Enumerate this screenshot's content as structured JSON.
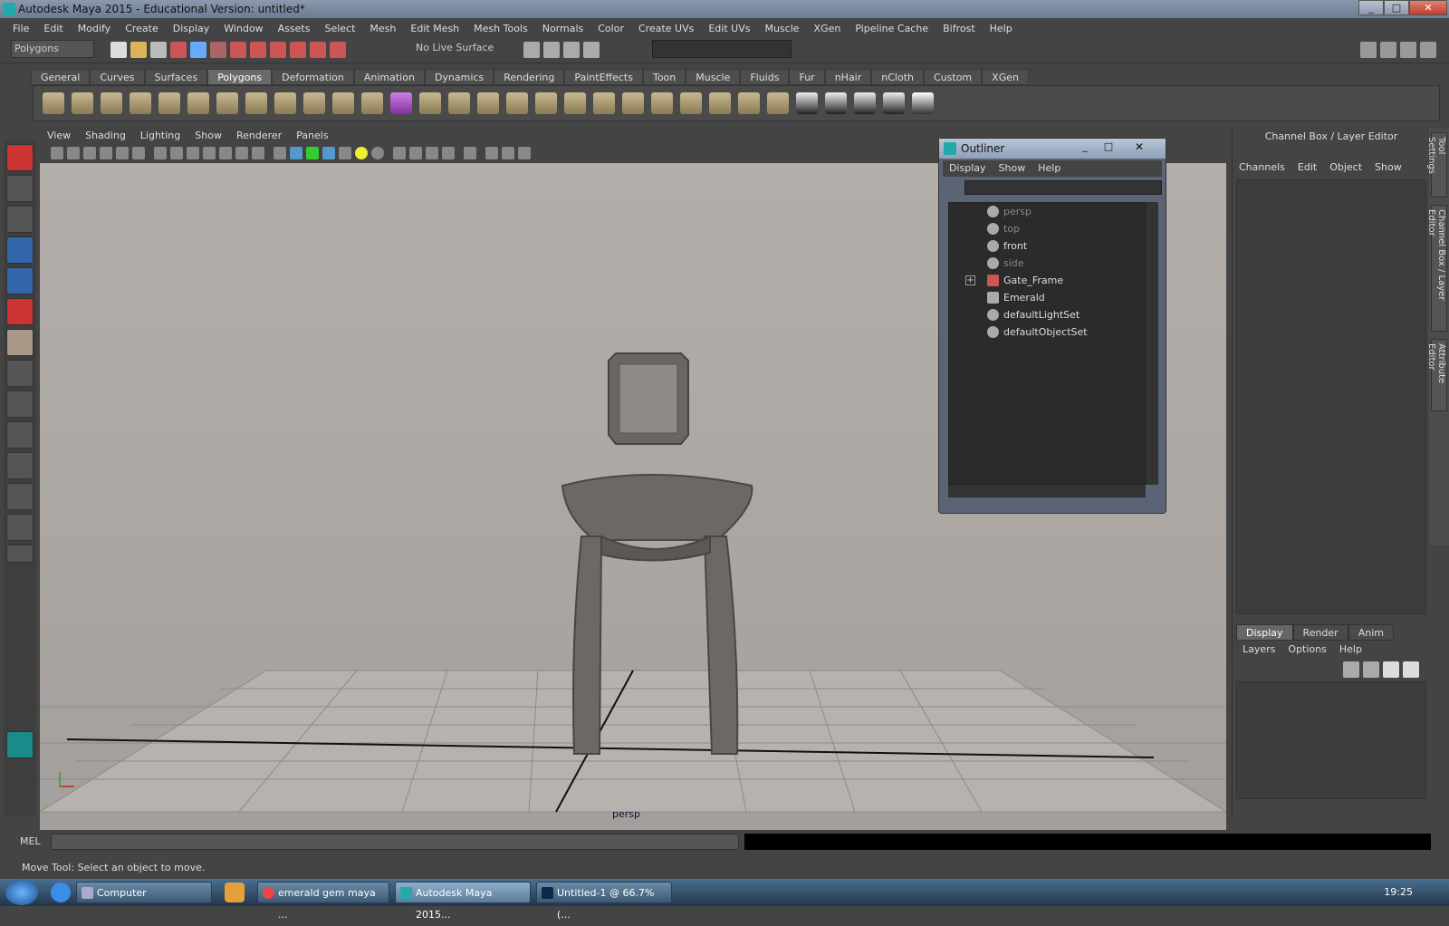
{
  "window": {
    "title": "Autodesk Maya 2015 - Educational Version: untitled*",
    "minimize": "_",
    "maximize": "□",
    "close": "✕"
  },
  "menubar": [
    "File",
    "Edit",
    "Modify",
    "Create",
    "Display",
    "Window",
    "Assets",
    "Select",
    "Mesh",
    "Edit Mesh",
    "Mesh Tools",
    "Normals",
    "Color",
    "Create UVs",
    "Edit UVs",
    "Muscle",
    "XGen",
    "Pipeline Cache",
    "Bifrost",
    "Help"
  ],
  "statusline": {
    "mode_selector": "Polygons",
    "live_surface": "No Live Surface"
  },
  "shelf_tabs": [
    "General",
    "Curves",
    "Surfaces",
    "Polygons",
    "Deformation",
    "Animation",
    "Dynamics",
    "Rendering",
    "PaintEffects",
    "Toon",
    "Muscle",
    "Fluids",
    "Fur",
    "nHair",
    "nCloth",
    "Custom",
    "XGen"
  ],
  "shelf_active": "Polygons",
  "viewport": {
    "menu": [
      "View",
      "Shading",
      "Lighting",
      "Show",
      "Renderer",
      "Panels"
    ],
    "camera_label": "persp"
  },
  "outliner": {
    "title": "Outliner",
    "menu": [
      "Display",
      "Show",
      "Help"
    ],
    "items": [
      {
        "label": "persp",
        "dim": true
      },
      {
        "label": "top",
        "dim": true
      },
      {
        "label": "front",
        "dim": false
      },
      {
        "label": "side",
        "dim": true
      },
      {
        "label": "Gate_Frame",
        "dim": false
      },
      {
        "label": "Emerald",
        "dim": false
      },
      {
        "label": "defaultLightSet",
        "dim": false
      },
      {
        "label": "defaultObjectSet",
        "dim": false
      }
    ]
  },
  "channel_box": {
    "title": "Channel Box / Layer Editor",
    "menu": [
      "Channels",
      "Edit",
      "Object",
      "Show"
    ],
    "layer_tabs": [
      "Display",
      "Render",
      "Anim"
    ],
    "layer_menu": [
      "Layers",
      "Options",
      "Help"
    ]
  },
  "side_tabs": [
    "Tool Settings",
    "Channel Box / Layer Editor",
    "Attribute Editor"
  ],
  "cmdline": {
    "label": "MEL"
  },
  "helpline": "Move Tool: Select an object to move.",
  "taskbar": {
    "items": [
      "Computer",
      "emerald gem maya ...",
      "Autodesk Maya 2015...",
      "Untitled-1 @ 66.7% (..."
    ],
    "clock": "19:25"
  }
}
